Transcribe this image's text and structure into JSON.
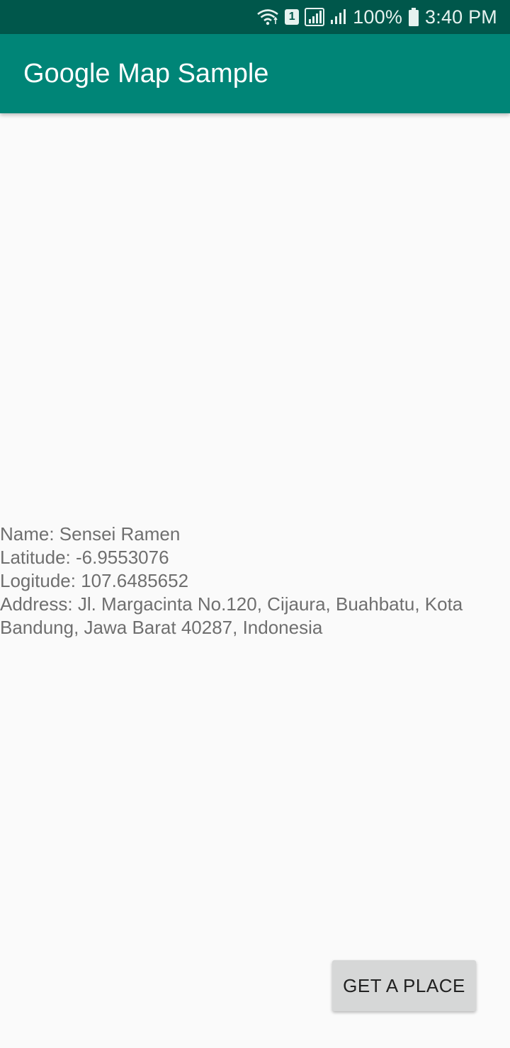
{
  "status_bar": {
    "battery": "100%",
    "time": "3:40 PM",
    "sim_slot": "1",
    "icons": [
      "wifi-icon",
      "sim-1-icon",
      "signal-icon",
      "signal-icon",
      "battery-icon"
    ]
  },
  "app_bar": {
    "title": "Google Map Sample",
    "color": "#008577",
    "status_color": "#00574b"
  },
  "place": {
    "name": "Name: Sensei Ramen",
    "latitude": "Latitude: -6.9553076",
    "longitude": "Logitude: 107.6485652",
    "address": "Address: Jl. Margacinta No.120, Cijaura, Buahbatu, Kota Bandung, Jawa Barat 40287, Indonesia"
  },
  "actions": {
    "get_place_label": "GET A PLACE"
  }
}
